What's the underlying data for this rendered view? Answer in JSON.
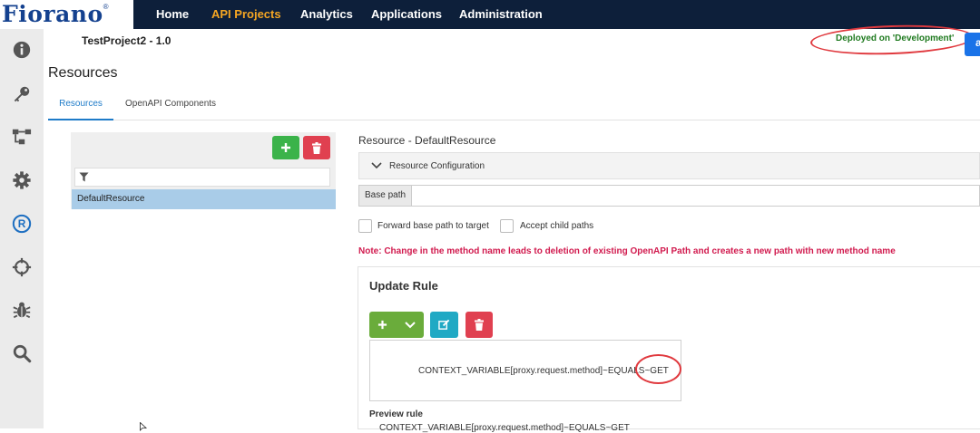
{
  "app": {
    "logo_text": "Fiorano",
    "logo_mark": "®"
  },
  "nav": {
    "items": [
      {
        "label": "Home",
        "active": false
      },
      {
        "label": "API Projects",
        "active": true
      },
      {
        "label": "Analytics",
        "active": false
      },
      {
        "label": "Applications",
        "active": false
      },
      {
        "label": "Administration",
        "active": false
      }
    ]
  },
  "sidebar": {
    "icons": [
      "info-icon",
      "key-icon",
      "flow-icon",
      "gear-icon",
      "registered-icon",
      "crosshair-icon",
      "bug-icon",
      "search-icon"
    ],
    "active_icon": "registered-icon"
  },
  "header": {
    "project_title": "TestProject2 - 1.0",
    "deploy_status": "Deployed on 'Development'",
    "page_heading": "Resources"
  },
  "tabs": [
    {
      "label": "Resources",
      "active": true
    },
    {
      "label": "OpenAPI Components",
      "active": false
    }
  ],
  "resources": {
    "items": [
      "DefaultResource"
    ],
    "selected": "DefaultResource"
  },
  "resource_config": {
    "title": "Resource - DefaultResource",
    "accordion_label": "Resource Configuration",
    "base_path_label": "Base path",
    "base_path_value": "",
    "forward_label": "Forward base path to target",
    "accept_child_label": "Accept child paths"
  },
  "note": "Note: Change in the method name leads to deletion of existing OpenAPI Path and creates a new path with new method name",
  "update_rule": {
    "title": "Update Rule",
    "rule_text": "CONTEXT_VARIABLE[proxy.request.method]~EQUALS~GET",
    "preview_label": "Preview rule",
    "preview_text": "CONTEXT_VARIABLE[proxy.request.method]~EQUALS~GET"
  },
  "colors": {
    "nav_bg": "#0d1f3a",
    "nav_active": "#f5a623",
    "deploy_green": "#1f7a1f",
    "note_red": "#d11a4e",
    "selected_row": "#a9cce8",
    "annotation_red": "#e0393e"
  }
}
